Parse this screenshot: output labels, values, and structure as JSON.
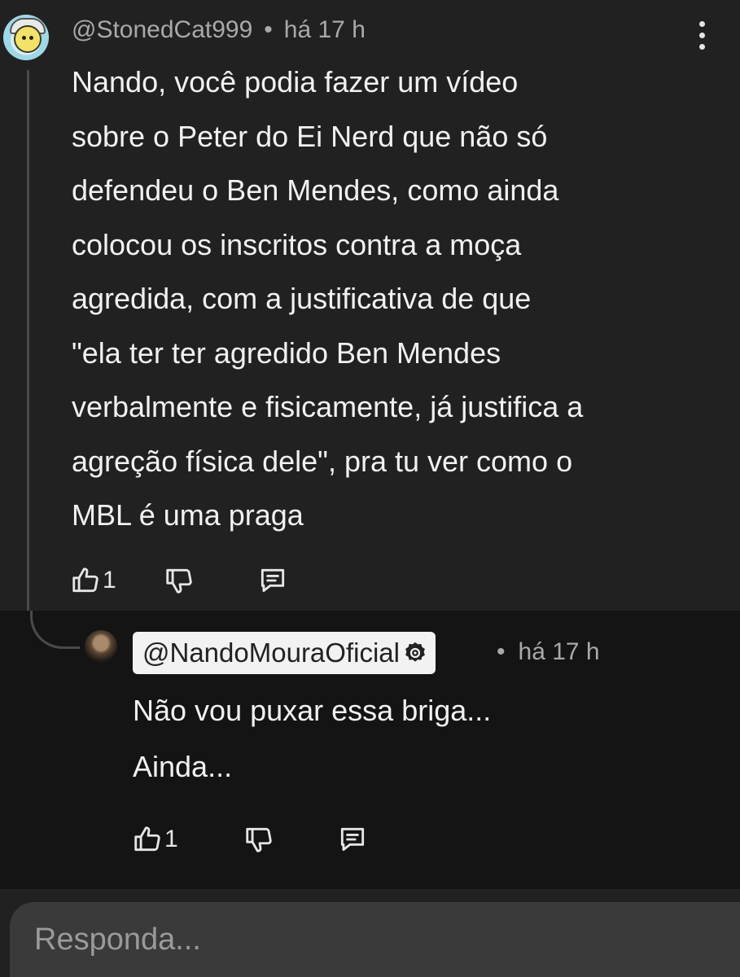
{
  "comment": {
    "username": "@StonedCat999",
    "separator": "•",
    "time": "há 17 h",
    "lines": [
      "Nando, você podia fazer um vídeo",
      "sobre o Peter do Ei Nerd que não só",
      "defendeu o Ben Mendes, como ainda",
      "colocou os inscritos contra a moça",
      "agredida, com a justificativa de que",
      "\"ela ter ter agredido Ben Mendes",
      "verbalmente e fisicamente, já justifica a",
      "agreção física dele\", pra tu ver como o",
      "MBL é uma praga"
    ],
    "likes": "1"
  },
  "reply": {
    "username": "@NandoMouraOficial",
    "separator": "•",
    "time": "há 17 h",
    "lines": [
      "Não vou puxar essa briga...",
      "Ainda..."
    ],
    "likes": "1"
  },
  "input": {
    "placeholder": "Responda..."
  },
  "colors": {
    "background": "#212121",
    "reply_background": "#141414",
    "input_background": "#3a3a3a",
    "meta_text": "#a9a9a9"
  },
  "icons": [
    "kebab-menu-icon",
    "like-icon",
    "dislike-icon",
    "reply-icon",
    "verified-badge-icon"
  ]
}
